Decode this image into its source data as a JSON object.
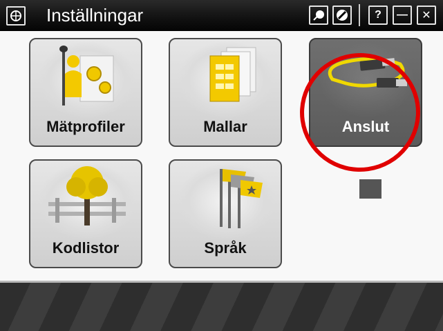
{
  "window": {
    "title": "Inställningar",
    "app_icon": "trimble-logo-icon",
    "controls": [
      {
        "name": "tools-icon"
      },
      {
        "name": "no-entry-icon"
      },
      {
        "name": "help-button",
        "label": "?"
      },
      {
        "name": "minimize-button",
        "label": "—"
      },
      {
        "name": "close-button",
        "label": "✕"
      }
    ]
  },
  "tiles": [
    {
      "id": "matprofiler",
      "label": "Mätprofiler",
      "icon": "survey-profile-icon"
    },
    {
      "id": "mallar",
      "label": "Mallar",
      "icon": "templates-icon"
    },
    {
      "id": "anslut",
      "label": "Anslut",
      "icon": "usb-cable-icon",
      "selected": true
    },
    {
      "id": "kodlistor",
      "label": "Kodlistor",
      "icon": "tree-fence-icon"
    },
    {
      "id": "sprak",
      "label": "Språk",
      "icon": "flags-icon"
    }
  ],
  "annotation": {
    "color": "#e00000"
  }
}
